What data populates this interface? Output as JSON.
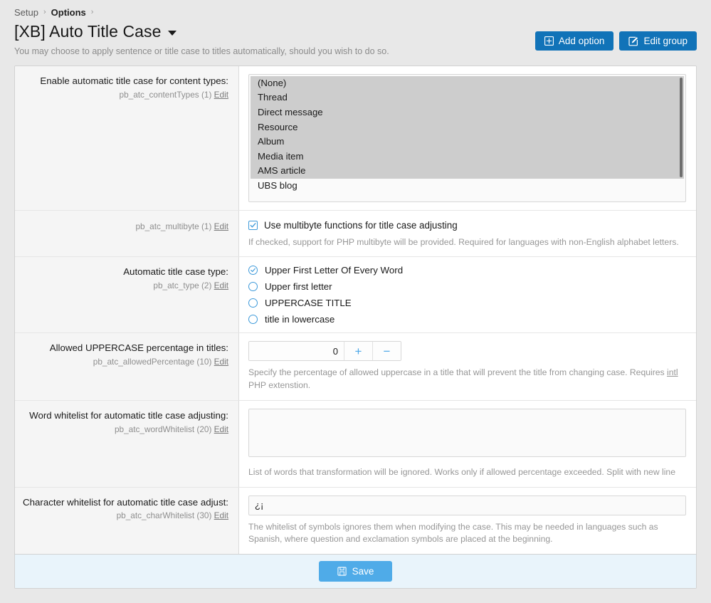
{
  "breadcrumb": {
    "items": [
      {
        "label": "Setup",
        "strong": false
      },
      {
        "label": "Options",
        "strong": true
      }
    ],
    "separator": "›"
  },
  "header": {
    "title": "[XB] Auto Title Case",
    "description": "You may choose to apply sentence or title case to titles automatically, should you wish to do so.",
    "add_option_label": "Add option",
    "edit_group_label": "Edit group"
  },
  "colors": {
    "primary_button": "#1173b8",
    "save_button": "#4fabe8",
    "accent": "#3e9ada",
    "footer_bg": "#e9f4fb",
    "label_bg": "#f5f5f5",
    "selection": "#cdcdcd"
  },
  "rows": {
    "content_types": {
      "label": "Enable automatic title case for content types:",
      "option_id": "pb_atc_contentTypes",
      "weight": "(1)",
      "edit_label": "Edit",
      "options": [
        {
          "label": "(None)",
          "selected": true
        },
        {
          "label": "Thread",
          "selected": true
        },
        {
          "label": "Direct message",
          "selected": true
        },
        {
          "label": "Resource",
          "selected": true
        },
        {
          "label": "Album",
          "selected": true
        },
        {
          "label": "Media item",
          "selected": true
        },
        {
          "label": "AMS article",
          "selected": true
        },
        {
          "label": "UBS blog",
          "selected": false
        }
      ]
    },
    "multibyte": {
      "option_id": "pb_atc_multibyte",
      "weight": "(1)",
      "edit_label": "Edit",
      "checkbox_label": "Use multibyte functions for title case adjusting",
      "checked": true,
      "hint": "If checked, support for PHP multibyte will be provided. Required for languages with non-English alphabet letters."
    },
    "title_case_type": {
      "label": "Automatic title case type:",
      "option_id": "pb_atc_type",
      "weight": "(2)",
      "edit_label": "Edit",
      "options": [
        {
          "label": "Upper First Letter Of Every Word",
          "selected": true
        },
        {
          "label": "Upper first letter",
          "selected": false
        },
        {
          "label": "UPPERCASE TITLE",
          "selected": false
        },
        {
          "label": "title in lowercase",
          "selected": false
        }
      ]
    },
    "allowed_percentage": {
      "label": "Allowed UPPERCASE percentage in titles:",
      "option_id": "pb_atc_allowedPercentage",
      "weight": "(10)",
      "edit_label": "Edit",
      "value": "0",
      "increment_label": "+",
      "decrement_label": "−",
      "hint_before": "Specify the percentage of allowed uppercase in a title that will prevent the title from changing case. Requires ",
      "hint_abbr": "intl",
      "hint_after": " PHP extenstion."
    },
    "word_whitelist": {
      "label": "Word whitelist for automatic title case adjusting:",
      "option_id": "pb_atc_wordWhitelist",
      "weight": "(20)",
      "edit_label": "Edit",
      "value": "",
      "hint": "List of words that transformation will be ignored. Works only if allowed percentage exceeded. Split with new line"
    },
    "char_whitelist": {
      "label": "Character whitelist for automatic title case adjust:",
      "option_id": "pb_atc_charWhitelist",
      "weight": "(30)",
      "edit_label": "Edit",
      "value": "¿¡",
      "hint": "The whitelist of symbols ignores them when modifying the case. This may be needed in languages such as Spanish, where question and exclamation symbols are placed at the beginning."
    }
  },
  "footer": {
    "save_label": "Save"
  }
}
